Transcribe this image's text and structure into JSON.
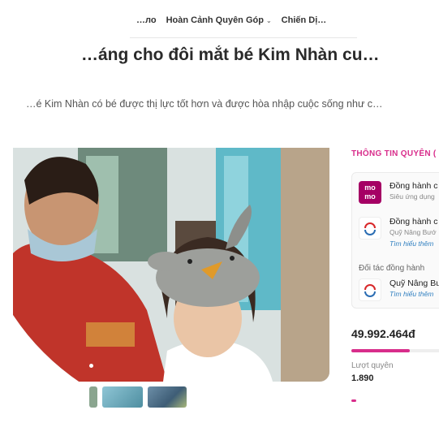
{
  "nav": {
    "items": [
      {
        "label": "…ло"
      },
      {
        "label": "Hoàn Cảnh Quyên Góp"
      },
      {
        "label": "Chiến Dị…"
      }
    ]
  },
  "title": "…áng cho đôi mắt bé Kim Nhàn cu…",
  "subtitle": "…é Kim Nhàn có bé được thị lực tốt hơn và được hòa nhập cuộc sống như c…",
  "panel": {
    "title": "THÔNG TIN QUYÊN (",
    "companions": [
      {
        "name": "Đồng hành c",
        "desc": "Siêu ứng dụng",
        "logo": "momo-logo",
        "logo_text": "mo mo"
      },
      {
        "name": "Đồng hành c",
        "desc": "Quỹ Nâng Bướ",
        "more": "Tìm hiểu thêm",
        "logo": "fund-logo"
      }
    ],
    "partner_label": "Đối tác đồng hành",
    "partner": {
      "name": "Quỹ Nâng Bư",
      "more": "Tìm hiểu thêm",
      "logo": "fund-logo"
    }
  },
  "stats": {
    "amount": "49.992.464đ",
    "progress": 0.6,
    "donors_label": "Lượt quyên",
    "donors_value": "1.890"
  },
  "colors": {
    "accent": "#d82d8b",
    "momo": "#a50064",
    "link": "#2f7fc0"
  }
}
